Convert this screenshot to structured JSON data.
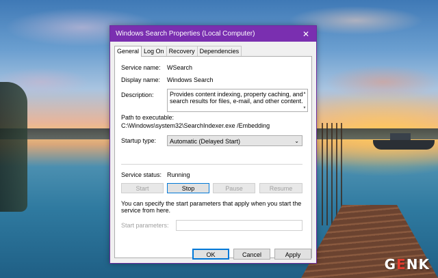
{
  "dialog": {
    "title": "Windows Search Properties (Local Computer)",
    "close_glyph": "✕",
    "tabs": [
      {
        "label": "General",
        "active": true
      },
      {
        "label": "Log On",
        "active": false
      },
      {
        "label": "Recovery",
        "active": false
      },
      {
        "label": "Dependencies",
        "active": false
      }
    ],
    "service_name_label": "Service name:",
    "service_name_value": "WSearch",
    "display_name_label": "Display name:",
    "display_name_value": "Windows Search",
    "description_label": "Description:",
    "description_value": "Provides content indexing, property caching, and search results for files, e-mail, and other content.",
    "path_label": "Path to executable:",
    "path_value": "C:\\Windows\\system32\\SearchIndexer.exe /Embedding",
    "startup_type_label": "Startup type:",
    "startup_type_value": "Automatic (Delayed Start)",
    "service_status_label": "Service status:",
    "service_status_value": "Running",
    "start_label": "Start",
    "stop_label": "Stop",
    "pause_label": "Pause",
    "resume_label": "Resume",
    "info_text": "You can specify the start parameters that apply when you start the service from here.",
    "start_params_label": "Start parameters:",
    "start_params_value": "",
    "ok_label": "OK",
    "cancel_label": "Cancel",
    "apply_label": "Apply"
  },
  "watermark": {
    "prefix": "G",
    "highlight": "E",
    "suffix": "NK"
  },
  "colors": {
    "titlebar": "#7a2fb0",
    "focus": "#0078d7"
  },
  "icons": {
    "close": "close-icon",
    "dropdown": "chevron-down-icon"
  }
}
